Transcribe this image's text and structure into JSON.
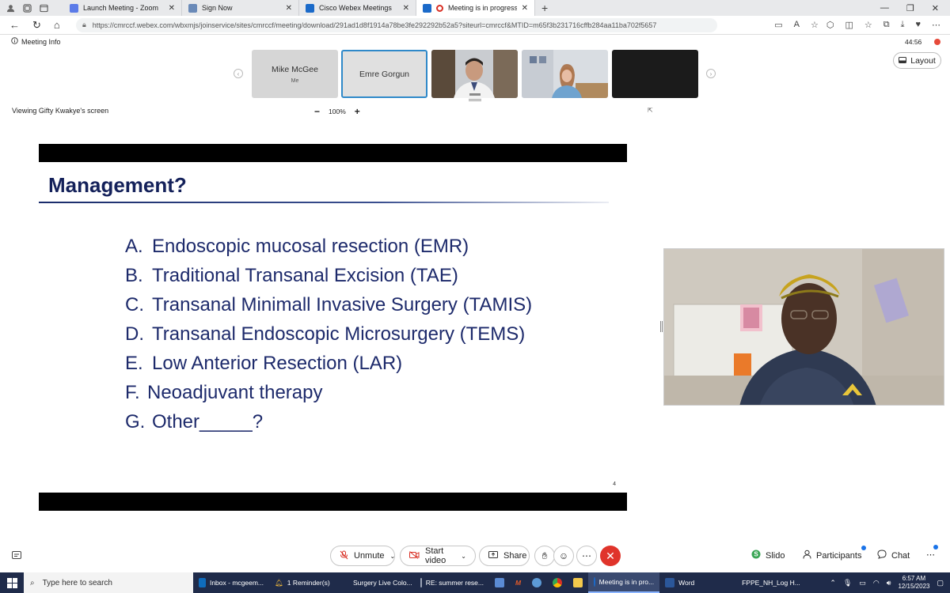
{
  "browser": {
    "tabs": [
      {
        "title": "Launch Meeting - Zoom",
        "favicon_color": "#5b7be8",
        "active": false
      },
      {
        "title": "Sign Now",
        "favicon_color": "#6a8ab8",
        "active": false
      },
      {
        "title": "Cisco Webex Meetings",
        "favicon_color": "#1b6ac9",
        "active": false
      },
      {
        "title": "Meeting is in progress...",
        "favicon_color": "#d93025",
        "active": true
      }
    ],
    "url": "https://cmrccf.webex.com/wbxmjs/joinservice/sites/cmrccf/meeting/download/291ad1d8f1914a78be3fe292292b52a5?siteurl=cmrccf&MTID=m65f3b231716cffb284aa11ba702f5657"
  },
  "meeting": {
    "info_label": "Meeting Info",
    "timer": "44:56",
    "layout_label": "Layout",
    "participants": [
      {
        "name": "Mike McGee",
        "subtitle": "Me",
        "type": "name"
      },
      {
        "name": "Emre Gorgun",
        "subtitle": "",
        "type": "name-selected"
      },
      {
        "name": "",
        "subtitle": "",
        "type": "video-man"
      },
      {
        "name": "",
        "subtitle": "",
        "type": "video-woman"
      },
      {
        "name": "",
        "subtitle": "",
        "type": "dark"
      }
    ],
    "viewing_label": "Viewing Gifty Kwakye's screen",
    "zoom_level": "100%"
  },
  "slide": {
    "title": "Management?",
    "items": [
      {
        "letter": "A.",
        "text": "Endoscopic mucosal resection (EMR)"
      },
      {
        "letter": "B.",
        "text": "Traditional Transanal Excision (TAE)"
      },
      {
        "letter": "C.",
        "text": "Transanal Minimall Invasive Surgery (TAMIS)"
      },
      {
        "letter": "D.",
        "text": "Transanal Endoscopic Microsurgery (TEMS)"
      },
      {
        "letter": "E.",
        "text": "Low Anterior Resection (LAR)"
      },
      {
        "letter": "F.",
        "text": "Neoadjuvant therapy"
      },
      {
        "letter": "G.",
        "text": "Other_____?"
      }
    ],
    "page_number": "4"
  },
  "controls": {
    "unmute": "Unmute",
    "start_video": "Start video",
    "share": "Share",
    "slido": "Slido",
    "participants": "Participants",
    "chat": "Chat"
  },
  "taskbar": {
    "search_placeholder": "Type here to search",
    "items": [
      {
        "label": "Inbox - mcgeem...",
        "color": "#0f6cbd"
      },
      {
        "label": "1 Reminder(s)",
        "color": "#e8b33a"
      },
      {
        "label": "Surgery Live Colo...",
        "color": "#8a8a8a"
      },
      {
        "label": "RE: summer rese...",
        "color": "#9aa3b5"
      }
    ],
    "active_item": {
      "label": "Meeting is in pro...",
      "color": "#1b6ac9"
    },
    "word_item": {
      "label": "Word",
      "color": "#2b579a"
    },
    "pdf_item": {
      "label": "FPPE_NH_Log H...",
      "color": "#d93025"
    },
    "time": "6:57 AM",
    "date": "12/15/2023"
  }
}
